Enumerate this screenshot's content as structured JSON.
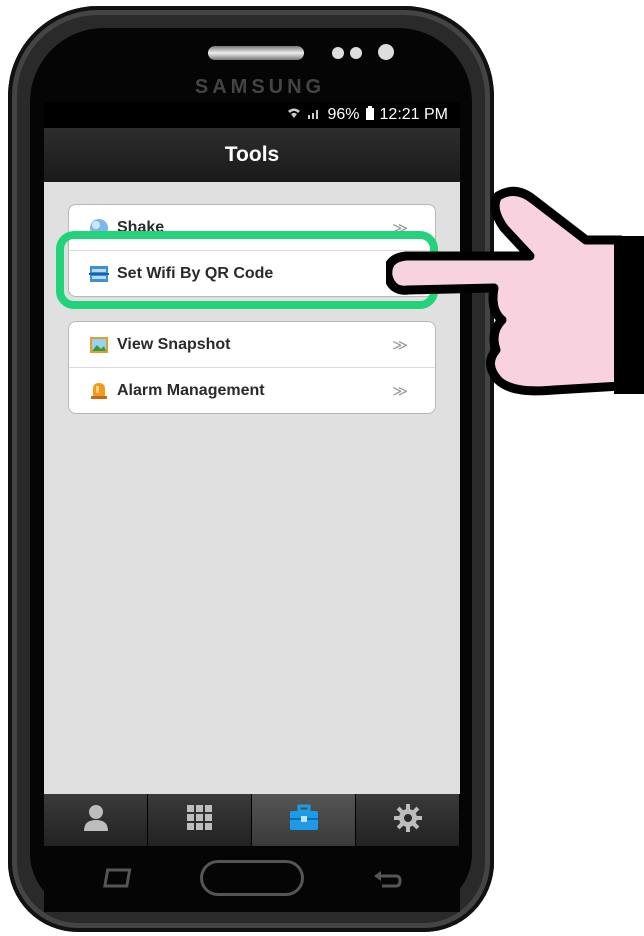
{
  "status_bar": {
    "battery": "96%",
    "time": "12:21 PM"
  },
  "device": {
    "brand": "SAMSUNG"
  },
  "header": {
    "title": "Tools"
  },
  "groups": [
    {
      "items": [
        {
          "label": "Shake",
          "icon": "globe-icon"
        },
        {
          "label": "Set Wifi By QR Code",
          "icon": "qr-scan-icon"
        }
      ]
    },
    {
      "items": [
        {
          "label": "View Snapshot",
          "icon": "picture-icon"
        },
        {
          "label": "Alarm Management",
          "icon": "alarm-bell-icon"
        }
      ]
    }
  ],
  "chevron": "≫",
  "tabs": [
    {
      "name": "contacts",
      "icon": "person-icon",
      "active": false
    },
    {
      "name": "apps",
      "icon": "grid-icon",
      "active": false
    },
    {
      "name": "tools",
      "icon": "toolbox-icon",
      "active": true
    },
    {
      "name": "settings",
      "icon": "gear-icon",
      "active": false
    }
  ],
  "colors": {
    "highlight": "#22d37c",
    "active_tab_icon": "#1e9be6",
    "hand_fill": "#f8d3df"
  }
}
